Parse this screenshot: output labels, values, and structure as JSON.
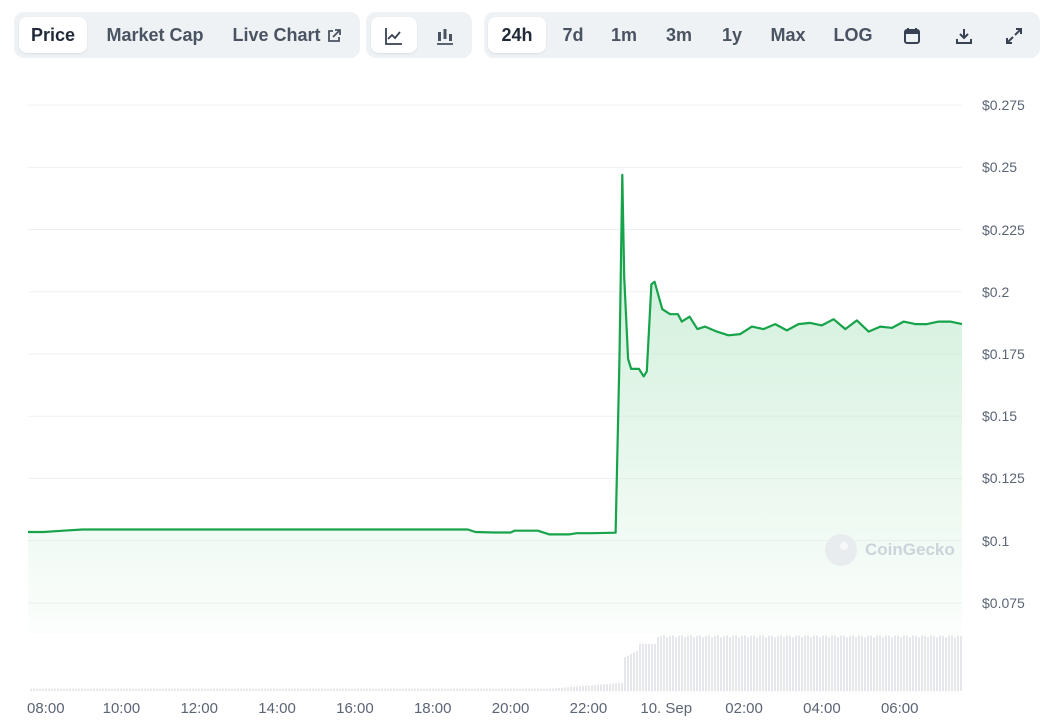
{
  "tabs": {
    "price": "Price",
    "market_cap": "Market Cap",
    "live_chart": "Live Chart"
  },
  "chart_type_icons": [
    "line-chart-icon",
    "candlestick-chart-icon"
  ],
  "ranges": [
    "24h",
    "7d",
    "1m",
    "3m",
    "1y",
    "Max",
    "LOG"
  ],
  "active_tab": "Price",
  "active_range": "24h",
  "action_icons": [
    "calendar-icon",
    "download-icon",
    "expand-icon"
  ],
  "watermark": "CoinGecko",
  "colors": {
    "line": "#16a34a",
    "fill_top": "#bfe9cd",
    "volume": "#e5e7eb",
    "grid": "#eef0f3"
  },
  "chart_data": {
    "type": "area",
    "ylim": [
      0.0625,
      0.2875
    ],
    "yticks": [
      "$0.275",
      "$0.25",
      "$0.225",
      "$0.2",
      "$0.175",
      "$0.15",
      "$0.125",
      "$0.1",
      "$0.075"
    ],
    "ytick_values": [
      0.275,
      0.25,
      0.225,
      0.2,
      0.175,
      0.15,
      0.125,
      0.1,
      0.075
    ],
    "xticks": [
      "08:00",
      "10:00",
      "12:00",
      "14:00",
      "16:00",
      "18:00",
      "20:00",
      "22:00",
      "10. Sep",
      "02:00",
      "04:00",
      "06:00"
    ],
    "xtick_hours": [
      8,
      10,
      12,
      14,
      16,
      18,
      20,
      22,
      24,
      26,
      28,
      30
    ],
    "x_range_hours": [
      7.6,
      31.6
    ],
    "series": [
      {
        "x_hours": [
          7.6,
          8.0,
          8.5,
          9.0,
          10.0,
          12.0,
          14.0,
          16.0,
          18.0,
          18.9,
          19.1,
          19.6,
          20.0,
          20.1,
          20.7,
          21.0,
          21.5,
          21.7,
          22.1,
          22.7,
          22.8,
          22.87,
          22.92,
          23.02,
          23.1,
          23.3,
          23.42,
          23.5,
          23.62,
          23.7,
          23.9,
          24.1,
          24.3,
          24.4,
          24.6,
          24.8,
          25.0,
          25.3,
          25.6,
          25.9,
          26.2,
          26.5,
          26.8,
          27.1,
          27.4,
          27.7,
          28.0,
          28.3,
          28.6,
          28.9,
          29.2,
          29.5,
          29.8,
          30.1,
          30.4,
          30.7,
          31.0,
          31.3,
          31.6
        ],
        "y": [
          0.1035,
          0.1035,
          0.104,
          0.1045,
          0.1045,
          0.1045,
          0.1045,
          0.1045,
          0.1045,
          0.1045,
          0.1035,
          0.1033,
          0.1033,
          0.104,
          0.104,
          0.1025,
          0.1025,
          0.103,
          0.103,
          0.1032,
          0.174,
          0.247,
          0.206,
          0.173,
          0.169,
          0.169,
          0.166,
          0.168,
          0.203,
          0.204,
          0.193,
          0.191,
          0.191,
          0.188,
          0.19,
          0.185,
          0.186,
          0.184,
          0.1825,
          0.183,
          0.186,
          0.185,
          0.187,
          0.1845,
          0.187,
          0.1875,
          0.1865,
          0.189,
          0.185,
          0.1885,
          0.184,
          0.186,
          0.1855,
          0.188,
          0.187,
          0.187,
          0.188,
          0.188,
          0.187
        ]
      }
    ],
    "volume_relative": {
      "low": 0.04,
      "high": 0.95,
      "spike_hour": 22.85
    },
    "grid": true,
    "legend": "none"
  }
}
